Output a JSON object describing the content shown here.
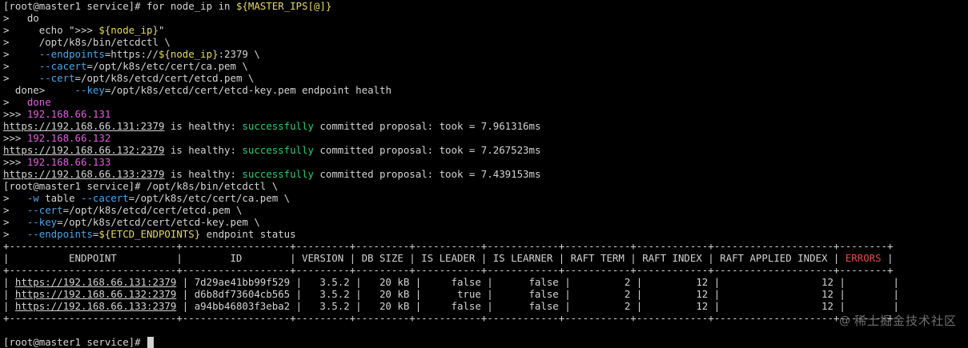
{
  "colors": {
    "background": "#000000",
    "default_text": "#d3d3d3",
    "yellow": "#e5d85c",
    "cyan": "#46a6e8",
    "magenta": "#e25ce0",
    "green": "#2ecc71",
    "red": "#e5484d",
    "watermark": "#6f6f6f"
  },
  "terminal": {
    "lines": [
      [
        [
          "[root@master1 service]# for node_ip ",
          "default"
        ],
        [
          "in",
          "default"
        ],
        [
          " ",
          "default"
        ],
        [
          "${MASTER_IPS[@]}",
          "yellow"
        ]
      ],
      [
        [
          ">   do",
          "default"
        ]
      ],
      [
        [
          ">     echo \">>> ",
          "default"
        ],
        [
          "${node_ip}",
          "yellow"
        ],
        [
          "\"",
          "default"
        ]
      ],
      [
        [
          ">     /opt/k8s/bin/etcdctl \\",
          "default"
        ]
      ],
      [
        [
          ">     ",
          "default"
        ],
        [
          "--endpoints",
          "cyan"
        ],
        [
          "=https://",
          "default"
        ],
        [
          "${node_ip}",
          "yellow"
        ],
        [
          ":2379 \\",
          "default"
        ]
      ],
      [
        [
          ">     ",
          "default"
        ],
        [
          "--cacert",
          "cyan"
        ],
        [
          "=/opt/k8s/etc/cert/ca.pem \\",
          "default"
        ]
      ],
      [
        [
          ">     ",
          "default"
        ],
        [
          "--cert",
          "cyan"
        ],
        [
          "=/opt/k8s/etcd/cert/etcd.pem \\",
          "default"
        ]
      ],
      [
        [
          "  done>     ",
          "default"
        ],
        [
          "--key",
          "cyan"
        ],
        [
          "=/opt/k8s/etcd/cert/etcd-key.pem endpoint health",
          "default"
        ]
      ],
      [
        [
          ">   ",
          "default"
        ],
        [
          "done",
          "magenta"
        ]
      ],
      [
        [
          ">>> ",
          "default"
        ],
        [
          "192.168.66.131",
          "magenta"
        ]
      ],
      [
        [
          "https://192.168.66.131:2379",
          "link"
        ],
        [
          " is healthy: ",
          "default"
        ],
        [
          "successfully",
          "green"
        ],
        [
          " committed proposal: took = 7.961316ms",
          "default"
        ]
      ],
      [
        [
          ">>> ",
          "default"
        ],
        [
          "192.168.66.132",
          "magenta"
        ]
      ],
      [
        [
          "https://192.168.66.132:2379",
          "link"
        ],
        [
          " is healthy: ",
          "default"
        ],
        [
          "successfully",
          "green"
        ],
        [
          " committed proposal: took = 7.267523ms",
          "default"
        ]
      ],
      [
        [
          ">>> ",
          "default"
        ],
        [
          "192.168.66.133",
          "magenta"
        ]
      ],
      [
        [
          "https://192.168.66.133:2379",
          "link"
        ],
        [
          " is healthy: ",
          "default"
        ],
        [
          "successfully",
          "green"
        ],
        [
          " committed proposal: took = 7.439153ms",
          "default"
        ]
      ],
      [
        [
          "[root@master1 service]# /opt/k8s/bin/etcdctl \\",
          "default"
        ]
      ],
      [
        [
          ">   ",
          "default"
        ],
        [
          "-w",
          "cyan"
        ],
        [
          " table ",
          "default"
        ],
        [
          "--cacert",
          "cyan"
        ],
        [
          "=/opt/k8s/etc/cert/ca.pem \\",
          "default"
        ]
      ],
      [
        [
          ">   ",
          "default"
        ],
        [
          "--cert",
          "cyan"
        ],
        [
          "=/opt/k8s/etcd/cert/etcd.pem \\",
          "default"
        ]
      ],
      [
        [
          ">   ",
          "default"
        ],
        [
          "--key",
          "cyan"
        ],
        [
          "=/opt/k8s/etcd/cert/etcd-key.pem \\",
          "default"
        ]
      ],
      [
        [
          ">   ",
          "default"
        ],
        [
          "--endpoints",
          "cyan"
        ],
        [
          "=",
          "default"
        ],
        [
          "${ETCD_ENDPOINTS}",
          "yellow"
        ],
        [
          " endpoint status",
          "default"
        ]
      ],
      [
        [
          "+----------------------------+------------------+---------+---------+-----------+------------+-----------+------------+--------------------+--------+",
          "default"
        ]
      ],
      [
        [
          "|          ENDPOINT          |        ID        | VERSION | DB SIZE | IS LEADER | IS LEARNER | RAFT TERM | RAFT INDEX | RAFT APPLIED INDEX | ",
          "default"
        ],
        [
          "ERRORS",
          "red"
        ],
        [
          " |",
          "default"
        ]
      ],
      [
        [
          "+----------------------------+------------------+---------+---------+-----------+------------+-----------+------------+--------------------+--------+",
          "default"
        ]
      ],
      [
        [
          "| ",
          "default"
        ],
        [
          "https://192.168.66.131:2379",
          "link"
        ],
        [
          " | 7d29ae41bb99f529 |   3.5.2 |   20 kB |     false |      false |         2 |         12 |                 12 |        |",
          "default"
        ]
      ],
      [
        [
          "| ",
          "default"
        ],
        [
          "https://192.168.66.132:2379",
          "link"
        ],
        [
          " | d6b8df73604cb565 |   3.5.2 |   20 kB |      true |      false |         2 |         12 |                 12 |        |",
          "default"
        ]
      ],
      [
        [
          "| ",
          "default"
        ],
        [
          "https://192.168.66.133:2379",
          "link"
        ],
        [
          " | a94bb46803f3eba2 |   3.5.2 |   20 kB |     false |      false |         2 |         12 |                 12 |        |",
          "default"
        ]
      ],
      [
        [
          "+----------------------------+------------------+---------+---------+-----------+------------+-----------+------------+--------------------+--------+",
          "default"
        ]
      ],
      [
        [
          "",
          "default"
        ]
      ],
      [
        [
          "[root@master1 service]# ",
          "default"
        ]
      ]
    ],
    "cursor_line_index": 28
  },
  "watermark": {
    "at": "@",
    "text": "稀土掘金技术社区"
  }
}
